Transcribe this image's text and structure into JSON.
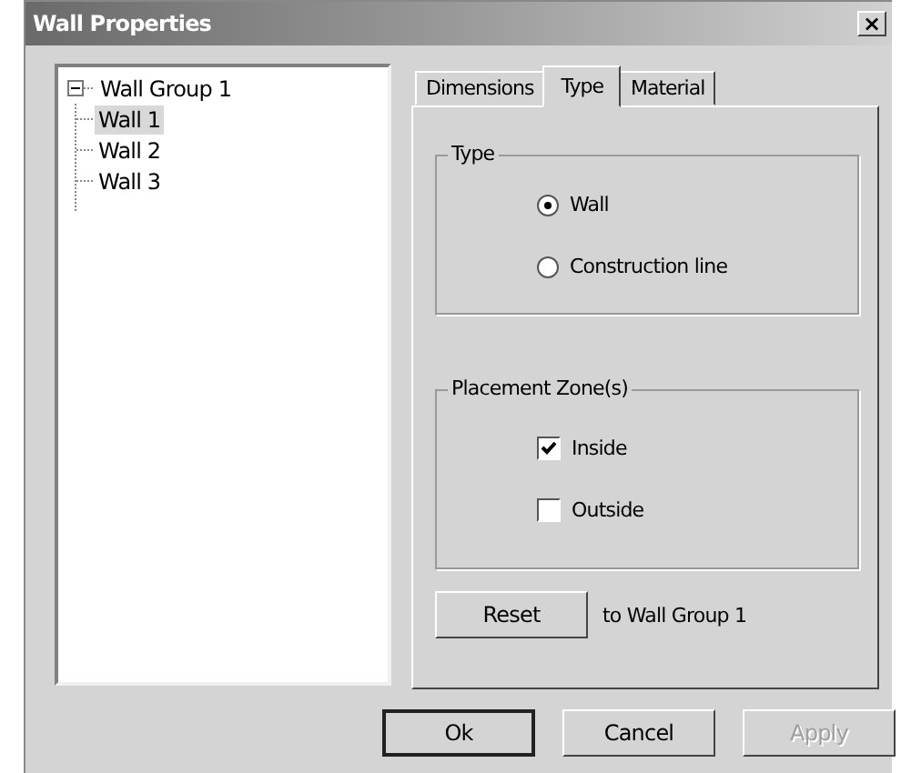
{
  "window": {
    "title": "Wall Properties",
    "close": "×"
  },
  "tree": [
    {
      "label": "Wall Group 1",
      "expanded": true,
      "selected": false,
      "children": [
        {
          "label": "Wall 1",
          "selected": true
        },
        {
          "label": "Wall 2",
          "selected": false
        },
        {
          "label": "Wall 3",
          "selected": false
        }
      ]
    }
  ],
  "tabs": [
    {
      "label": "Dimensions",
      "selected": false
    },
    {
      "label": "Type",
      "selected": true
    },
    {
      "label": "Material",
      "selected": false
    }
  ],
  "type_group": {
    "title": "Type",
    "options": [
      {
        "label": "Wall",
        "selected": true
      },
      {
        "label": "Construction line",
        "selected": false
      }
    ]
  },
  "zone_group": {
    "title": "Placement Zone(s)",
    "options": [
      {
        "label": "Inside",
        "checked": true
      },
      {
        "label": "Outside",
        "checked": false
      }
    ]
  },
  "reset": {
    "button": "Reset",
    "text": "to Wall Group 1"
  },
  "buttons": [
    {
      "label": "Ok",
      "default": true,
      "disabled": false
    },
    {
      "label": "Cancel",
      "default": false,
      "disabled": false
    },
    {
      "label": "Apply",
      "default": false,
      "disabled": true
    }
  ]
}
